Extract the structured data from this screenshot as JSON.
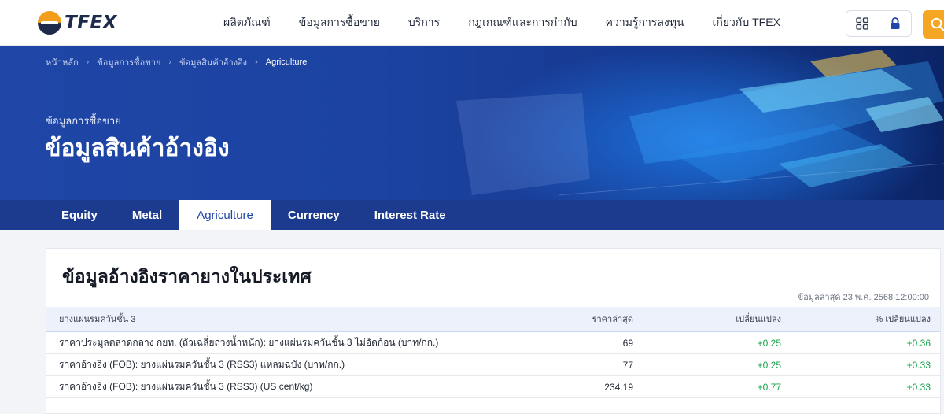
{
  "brand": {
    "name": "TFEX"
  },
  "nav": {
    "items": [
      "ผลิตภัณฑ์",
      "ข้อมูลการซื้อขาย",
      "บริการ",
      "กฎเกณฑ์และการกำกับ",
      "ความรู้การลงทุน",
      "เกี่ยวกับ TFEX"
    ]
  },
  "breadcrumb": [
    "หน้าหลัก",
    "ข้อมูลการซื้อขาย",
    "ข้อมูลสินค้าอ้างอิง",
    "Agriculture"
  ],
  "hero": {
    "subtitle": "ข้อมูลการซื้อขาย",
    "title": "ข้อมูลสินค้าอ้างอิง"
  },
  "tabs": [
    "Equity",
    "Metal",
    "Agriculture",
    "Currency",
    "Interest Rate"
  ],
  "active_tab": "Agriculture",
  "card": {
    "title": "ข้อมูลอ้างอิงราคายางในประเทศ",
    "updated": "ข้อมูลล่าสุด 23 พ.ค. 2568 12:00:00",
    "columns": [
      "ยางแผ่นรมควันชั้น 3",
      "ราคาล่าสุด",
      "เปลี่ยนแปลง",
      "% เปลี่ยนแปลง"
    ],
    "rows": [
      {
        "name": "ราคาประมูลตลาดกลาง กยท. (ถัวเฉลี่ยถ่วงน้ำหนัก): ยางแผ่นรมควันชั้น 3 ไม่อัดก้อน (บาท/กก.)",
        "last": "69",
        "change": "+0.25",
        "pct": "+0.36"
      },
      {
        "name": "ราคาอ้างอิง (FOB): ยางแผ่นรมควันชั้น 3 (RSS3) แหลมฉบัง (บาท/กก.)",
        "last": "77",
        "change": "+0.25",
        "pct": "+0.33"
      },
      {
        "name": "ราคาอ้างอิง (FOB): ยางแผ่นรมควันชั้น 3 (RSS3) (US cent/kg)",
        "last": "234.19",
        "change": "+0.77",
        "pct": "+0.33"
      }
    ]
  },
  "colors": {
    "brand_blue": "#1f46a6",
    "accent_orange": "#f5a623",
    "positive_green": "#16a34a"
  },
  "icons": [
    "apps-grid-icon",
    "lock-icon",
    "search-icon",
    "chevron-right-icon"
  ]
}
